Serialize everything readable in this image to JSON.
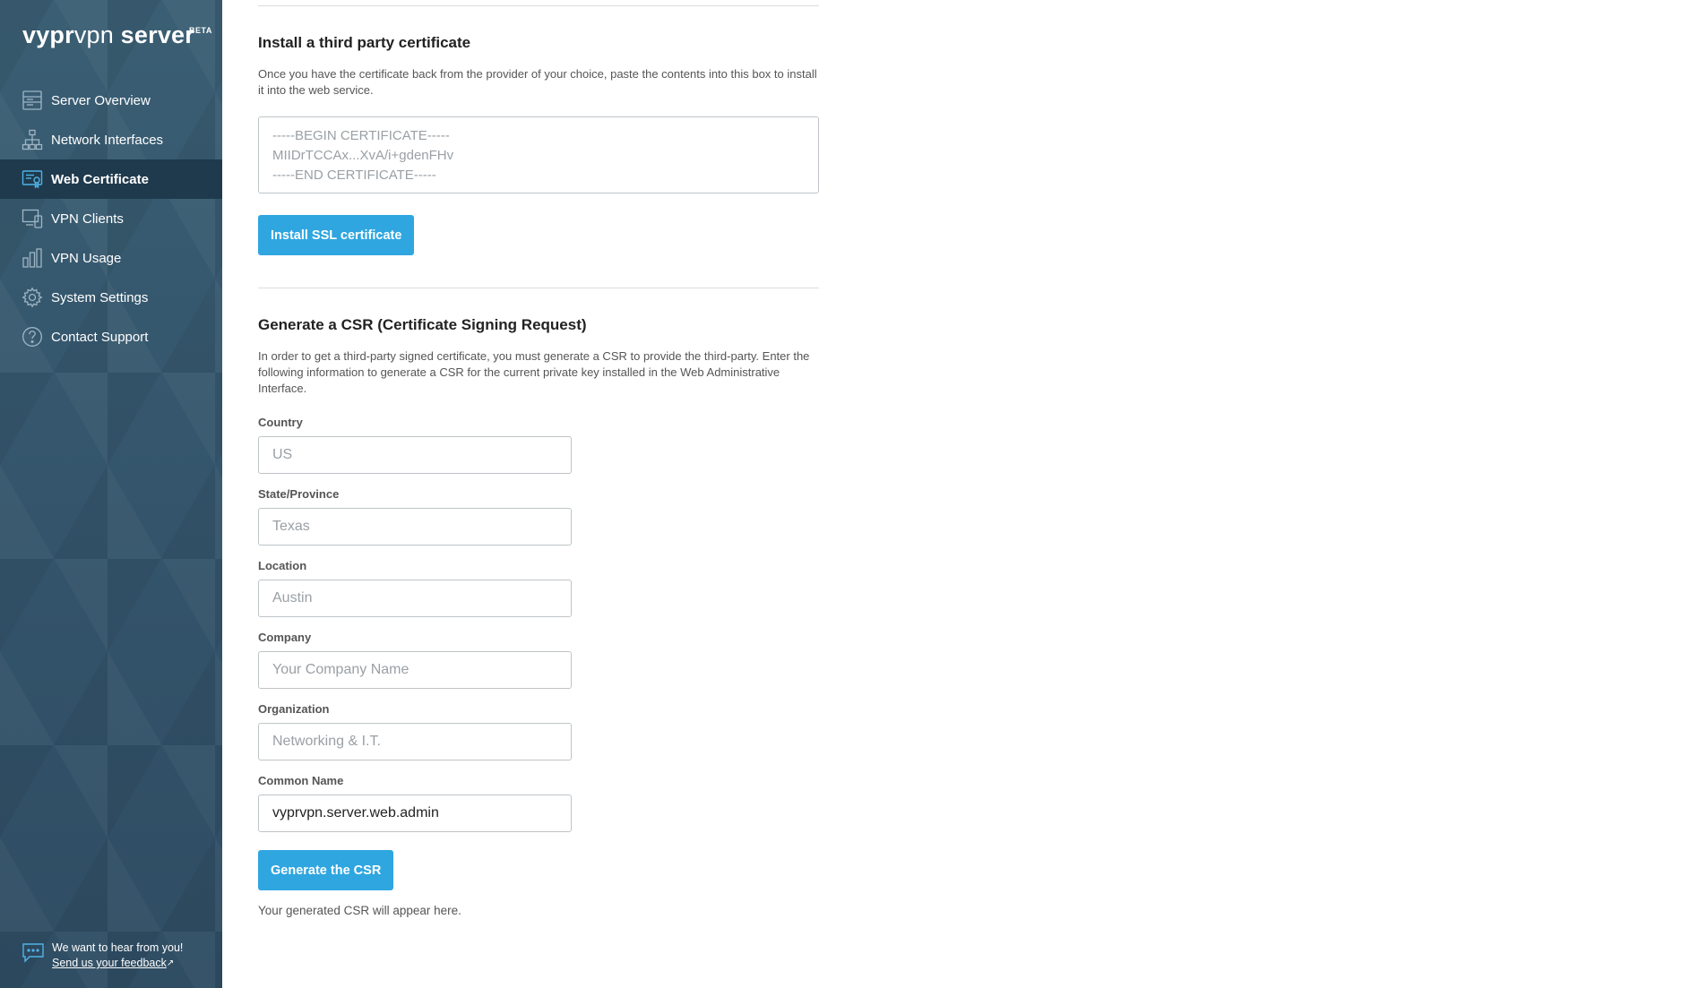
{
  "brand": {
    "bold": "vypr",
    "light": "vpn",
    "rest": " server",
    "badge": "BETA"
  },
  "sidebar": {
    "items": [
      {
        "label": "Server Overview",
        "icon": "server-overview-icon",
        "active": false
      },
      {
        "label": "Network Interfaces",
        "icon": "network-icon",
        "active": false
      },
      {
        "label": "Web Certificate",
        "icon": "certificate-icon",
        "active": true
      },
      {
        "label": "VPN Clients",
        "icon": "devices-icon",
        "active": false
      },
      {
        "label": "VPN Usage",
        "icon": "bar-chart-icon",
        "active": false
      },
      {
        "label": "System Settings",
        "icon": "gear-icon",
        "active": false
      },
      {
        "label": "Contact Support",
        "icon": "help-icon",
        "active": false
      }
    ],
    "feedback": {
      "text": "We want to hear from you!",
      "link": "Send us your feedback"
    }
  },
  "install": {
    "title": "Install a third party certificate",
    "description": "Once you have the certificate back from the provider of your choice, paste the contents into this box to install it into the web service.",
    "placeholder_lines": [
      "-----BEGIN CERTIFICATE-----",
      "MIIDrTCCAx...XvA/i+gdenFHv",
      "-----END CERTIFICATE-----"
    ],
    "button": "Install SSL certificate"
  },
  "csr": {
    "title": "Generate a CSR (Certificate Signing Request)",
    "description": "In order to get a third-party signed certificate, you must generate a CSR to provide the third-party. Enter the following information to generate a CSR for the current private key installed in the Web Administrative Interface.",
    "fields": [
      {
        "label": "Country",
        "placeholder": "US",
        "value": ""
      },
      {
        "label": "State/Province",
        "placeholder": "Texas",
        "value": ""
      },
      {
        "label": "Location",
        "placeholder": "Austin",
        "value": ""
      },
      {
        "label": "Company",
        "placeholder": "Your Company Name",
        "value": ""
      },
      {
        "label": "Organization",
        "placeholder": "Networking & I.T.",
        "value": ""
      },
      {
        "label": "Common Name",
        "placeholder": "",
        "value": "vyprvpn.server.web.admin"
      }
    ],
    "button": "Generate the CSR",
    "result_note": "Your generated CSR will appear here."
  },
  "colors": {
    "sidebar_bg": "#36576b",
    "sidebar_active": "#1f3a4d",
    "accent_button": "#2fa6e0"
  }
}
